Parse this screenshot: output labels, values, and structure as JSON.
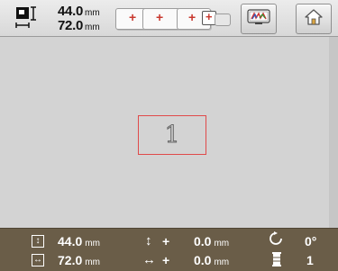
{
  "size": {
    "width_value": "44.0",
    "height_value": "72.0",
    "unit": "mm"
  },
  "toolbar": {
    "frames": [
      "+",
      "+",
      "+"
    ],
    "selected_frame": "+",
    "multi_color_icon": "mw-color-icon",
    "home_icon": "home-icon"
  },
  "canvas": {
    "design_glyph": "1",
    "design_box_color": "#e04a4a"
  },
  "status": {
    "height": {
      "value": "44.0",
      "unit": "mm"
    },
    "width": {
      "value": "72.0",
      "unit": "mm"
    },
    "vertical_offset": {
      "sign": "+",
      "value": "0.0",
      "unit": "mm"
    },
    "horizontal_offset": {
      "sign": "+",
      "value": "0.0",
      "unit": "mm"
    },
    "rotation": "0°",
    "thread_count": "1"
  },
  "colors": {
    "status_bar": "#6a5d48",
    "accent_red": "#c8382e"
  }
}
